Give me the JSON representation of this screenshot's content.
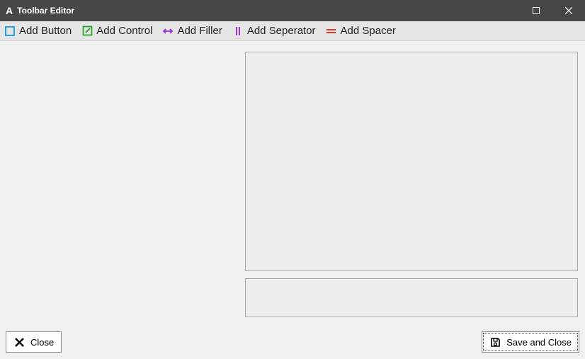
{
  "window": {
    "title": "Toolbar Editor",
    "app_letter": "A"
  },
  "toolbar": {
    "add_button": "Add Button",
    "add_control": "Add Control",
    "add_filler": "Add Filler",
    "add_separator": "Add Seperator",
    "add_spacer": "Add Spacer"
  },
  "footer": {
    "close": "Close",
    "save_and_close": "Save and Close"
  },
  "icon_colors": {
    "button": "#29a3e8",
    "control": "#2fa12f",
    "filler": "#9b30d9",
    "separator": "#9b30d9",
    "spacer": "#d63a2e"
  }
}
